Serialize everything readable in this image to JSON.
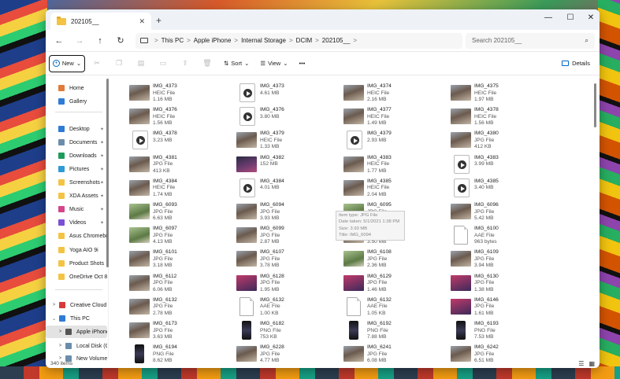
{
  "window": {
    "tab_title": "202105__",
    "new_tab": "+",
    "minimize": "—",
    "maximize": "☐",
    "close": "✕",
    "tab_close": "✕"
  },
  "nav": {
    "back": "←",
    "forward": "→",
    "up": "↑",
    "refresh": "↻"
  },
  "breadcrumb": [
    "This PC",
    "Apple iPhone",
    "Internal Storage",
    "DCIM",
    "202105__"
  ],
  "breadcrumb_sep": ">",
  "search": {
    "placeholder": "Search 202105__",
    "icon": "⌕"
  },
  "toolbar": {
    "new_label": "New",
    "new_chevron": "⌄",
    "sort_label": "Sort",
    "view_label": "View",
    "more": "•••",
    "details_label": "Details",
    "sort_icon": "⇅",
    "view_icon": "☰",
    "chevron": "⌄"
  },
  "sidebar": [
    {
      "label": "Home",
      "icon": "home-icon",
      "color": "#e07b39",
      "chev": "",
      "pin": ""
    },
    {
      "label": "Gallery",
      "icon": "gallery-icon",
      "color": "#2f7bd6",
      "chev": "",
      "pin": ""
    },
    {
      "label": "Desktop",
      "icon": "desktop-icon",
      "color": "#2f7bd6",
      "chev": "",
      "pin": "✦"
    },
    {
      "label": "Documents",
      "icon": "documents-icon",
      "color": "#6b8dab",
      "chev": "",
      "pin": "✦"
    },
    {
      "label": "Downloads",
      "icon": "downloads-icon",
      "color": "#1e9c5a",
      "chev": "",
      "pin": "✦"
    },
    {
      "label": "Pictures",
      "icon": "pictures-icon",
      "color": "#2f9bd6",
      "chev": "",
      "pin": "✦"
    },
    {
      "label": "Screenshots",
      "icon": "folder-icon",
      "color": "#f3c344",
      "chev": "",
      "pin": "✦"
    },
    {
      "label": "XDA Assets",
      "icon": "folder-icon",
      "color": "#f3c344",
      "chev": "",
      "pin": "✦"
    },
    {
      "label": "Music",
      "icon": "music-icon",
      "color": "#d6448a",
      "chev": "",
      "pin": "✦"
    },
    {
      "label": "Videos",
      "icon": "videos-icon",
      "color": "#7b4fd6",
      "chev": "",
      "pin": "✦"
    },
    {
      "label": "Asus Chromebook",
      "icon": "folder-icon",
      "color": "#f3c344",
      "chev": "",
      "pin": ""
    },
    {
      "label": "Yoga AIO 9i",
      "icon": "folder-icon",
      "color": "#f3c344",
      "chev": "",
      "pin": ""
    },
    {
      "label": "Product Shots",
      "icon": "folder-icon",
      "color": "#f3c344",
      "chev": "",
      "pin": ""
    },
    {
      "label": "OneDrive Oct 8",
      "icon": "folder-icon",
      "color": "#f3c344",
      "chev": "",
      "pin": ""
    },
    {
      "label": "Creative Cloud Files",
      "icon": "cloud-icon",
      "color": "#d63a3a",
      "chev": ">",
      "pin": ""
    },
    {
      "label": "This PC",
      "icon": "this-pc-icon",
      "color": "#2f7bd6",
      "chev": "⌄",
      "pin": ""
    },
    {
      "label": "Apple iPhone",
      "icon": "phone-icon",
      "color": "#555555",
      "chev": ">",
      "pin": ""
    },
    {
      "label": "Local Disk (C:)",
      "icon": "drive-icon",
      "color": "#6b8dab",
      "chev": ">",
      "pin": ""
    },
    {
      "label": "New Volume (D:)",
      "icon": "drive-icon",
      "color": "#6b8dab",
      "chev": ">",
      "pin": ""
    }
  ],
  "files": [
    {
      "name": "IMG_4373",
      "type": "HEIC File",
      "size": "1.16 MB",
      "kind": "photo"
    },
    {
      "name": "IMG_4373",
      "type": "",
      "size": "4.61 MB",
      "kind": "vid"
    },
    {
      "name": "IMG_4374",
      "type": "HEIC File",
      "size": "2.16 MB",
      "kind": "photo"
    },
    {
      "name": "IMG_4375",
      "type": "HEIC File",
      "size": "1.97 MB",
      "kind": "photo"
    },
    {
      "name": "IMG_4376",
      "type": "HEIC File",
      "size": "1.56 MB",
      "kind": "photo"
    },
    {
      "name": "IMG_4376",
      "type": "",
      "size": "3.80 MB",
      "kind": "vid"
    },
    {
      "name": "IMG_4377",
      "type": "HEIC File",
      "size": "1.49 MB",
      "kind": "photo"
    },
    {
      "name": "IMG_4378",
      "type": "HEIC File",
      "size": "1.56 MB",
      "kind": "photo"
    },
    {
      "name": "IMG_4378",
      "type": "",
      "size": "3.23 MB",
      "kind": "vid"
    },
    {
      "name": "IMG_4379",
      "type": "HEIC File",
      "size": "1.33 MB",
      "kind": "photo"
    },
    {
      "name": "IMG_4379",
      "type": "",
      "size": "2.93 MB",
      "kind": "vid"
    },
    {
      "name": "IMG_4380",
      "type": "JPG File",
      "size": "412 KB",
      "kind": "photo"
    },
    {
      "name": "IMG_4381",
      "type": "JPG File",
      "size": "413 KB",
      "kind": "photo"
    },
    {
      "name": "IMG_4382",
      "type": "",
      "size": "152 MB",
      "kind": "dark"
    },
    {
      "name": "IMG_4383",
      "type": "HEIC File",
      "size": "1.77 MB",
      "kind": "photo"
    },
    {
      "name": "IMG_4383",
      "type": "",
      "size": "3.99 MB",
      "kind": "vid"
    },
    {
      "name": "IMG_4384",
      "type": "HEIC File",
      "size": "1.74 MB",
      "kind": "photo"
    },
    {
      "name": "IMG_4384",
      "type": "",
      "size": "4.01 MB",
      "kind": "vid"
    },
    {
      "name": "IMG_4385",
      "type": "HEIC File",
      "size": "2.04 MB",
      "kind": "photo"
    },
    {
      "name": "IMG_4385",
      "type": "",
      "size": "3.40 MB",
      "kind": "vid"
    },
    {
      "name": "IMG_6093",
      "type": "JPG File",
      "size": "6.63 MB",
      "kind": "green"
    },
    {
      "name": "IMG_6094",
      "type": "JPG File",
      "size": "3.93 MB",
      "kind": "photo"
    },
    {
      "name": "IMG_6095",
      "type": "JPG File",
      "size": "5.52 MB",
      "kind": "green"
    },
    {
      "name": "IMG_6096",
      "type": "JPG File",
      "size": "5.42 MB",
      "kind": "photo"
    },
    {
      "name": "IMG_6097",
      "type": "JPG File",
      "size": "4.13 MB",
      "kind": "green"
    },
    {
      "name": "IMG_6099",
      "type": "JPG File",
      "size": "2.87 MB",
      "kind": "photo"
    },
    {
      "name": "IMG_6100",
      "type": "JPG File",
      "size": "3.50 MB",
      "kind": "photo"
    },
    {
      "name": "IMG_6100",
      "type": "AAE File",
      "size": "963 bytes",
      "kind": "doc"
    },
    {
      "name": "IMG_6101",
      "type": "JPG File",
      "size": "3.18 MB",
      "kind": "photo"
    },
    {
      "name": "IMG_6107",
      "type": "JPG File",
      "size": "3.78 MB",
      "kind": "photo"
    },
    {
      "name": "IMG_6108",
      "type": "JPG File",
      "size": "2.36 MB",
      "kind": "green"
    },
    {
      "name": "IMG_6109",
      "type": "JPG File",
      "size": "3.94 MB",
      "kind": "photo"
    },
    {
      "name": "IMG_6112",
      "type": "JPG File",
      "size": "6.06 MB",
      "kind": "photo"
    },
    {
      "name": "IMG_6128",
      "type": "JPG File",
      "size": "1.95 MB",
      "kind": "pink"
    },
    {
      "name": "IMG_6129",
      "type": "JPG File",
      "size": "1.46 MB",
      "kind": "pink"
    },
    {
      "name": "IMG_6130",
      "type": "JPG File",
      "size": "1.38 MB",
      "kind": "pink"
    },
    {
      "name": "IMG_6132",
      "type": "JPG File",
      "size": "2.78 MB",
      "kind": "photo"
    },
    {
      "name": "IMG_6132",
      "type": "AAE File",
      "size": "1.00 KB",
      "kind": "doc"
    },
    {
      "name": "IMG_6132",
      "type": "AAE File",
      "size": "1.05 KB",
      "kind": "doc"
    },
    {
      "name": "IMG_6146",
      "type": "JPG File",
      "size": "1.61 MB",
      "kind": "pink"
    },
    {
      "name": "IMG_6173",
      "type": "JPG File",
      "size": "3.63 MB",
      "kind": "photo"
    },
    {
      "name": "IMG_6182",
      "type": "PNG File",
      "size": "753 KB",
      "kind": "phone"
    },
    {
      "name": "IMG_6192",
      "type": "PNG File",
      "size": "7.88 MB",
      "kind": "phone"
    },
    {
      "name": "IMG_6193",
      "type": "PNG File",
      "size": "7.53 MB",
      "kind": "phone"
    },
    {
      "name": "IMG_6194",
      "type": "PNG File",
      "size": "8.62 MB",
      "kind": "phone"
    },
    {
      "name": "IMG_6228",
      "type": "JPG File",
      "size": "4.77 MB",
      "kind": "photo"
    },
    {
      "name": "IMG_6241",
      "type": "JPG File",
      "size": "6.08 MB",
      "kind": "photo"
    },
    {
      "name": "IMG_6242",
      "type": "JPG File",
      "size": "6.51 MB",
      "kind": "photo"
    }
  ],
  "tooltip": {
    "line1": "Item type: JPG File",
    "line2": "Date taken: 5/1/2021 1:38 PM",
    "line3": "Size: 3.93 MB",
    "line4": "Title: IMG_6094"
  },
  "status": {
    "count": "340 items",
    "list_icon": "☰",
    "grid_icon": "▦"
  }
}
